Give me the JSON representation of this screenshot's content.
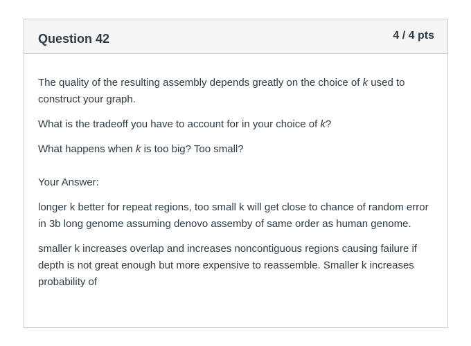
{
  "question": {
    "title": "Question 42",
    "points": "4 / 4 pts",
    "prompt": {
      "p1_before": "The quality of the resulting assembly depends greatly on the choice of ",
      "p1_k": "k",
      "p1_after": " used to construct your graph.",
      "p2_before": "What is the tradeoff you have to account for in your choice of ",
      "p2_k": "k",
      "p2_after": "?",
      "p3_before": "What happens when ",
      "p3_k": "k",
      "p3_after": " is too big? Too small?"
    },
    "answer_label": "Your Answer:",
    "answer_paragraphs": [
      "longer k better for repeat regions, too small k will get close to chance of random error in 3b long genome assuming denovo assemby of same order as human genome.",
      "smaller k increases overlap and increases noncontiguous regions causing failure if depth is not great enough but more expensive to reassemble. Smaller k increases probability of"
    ]
  }
}
